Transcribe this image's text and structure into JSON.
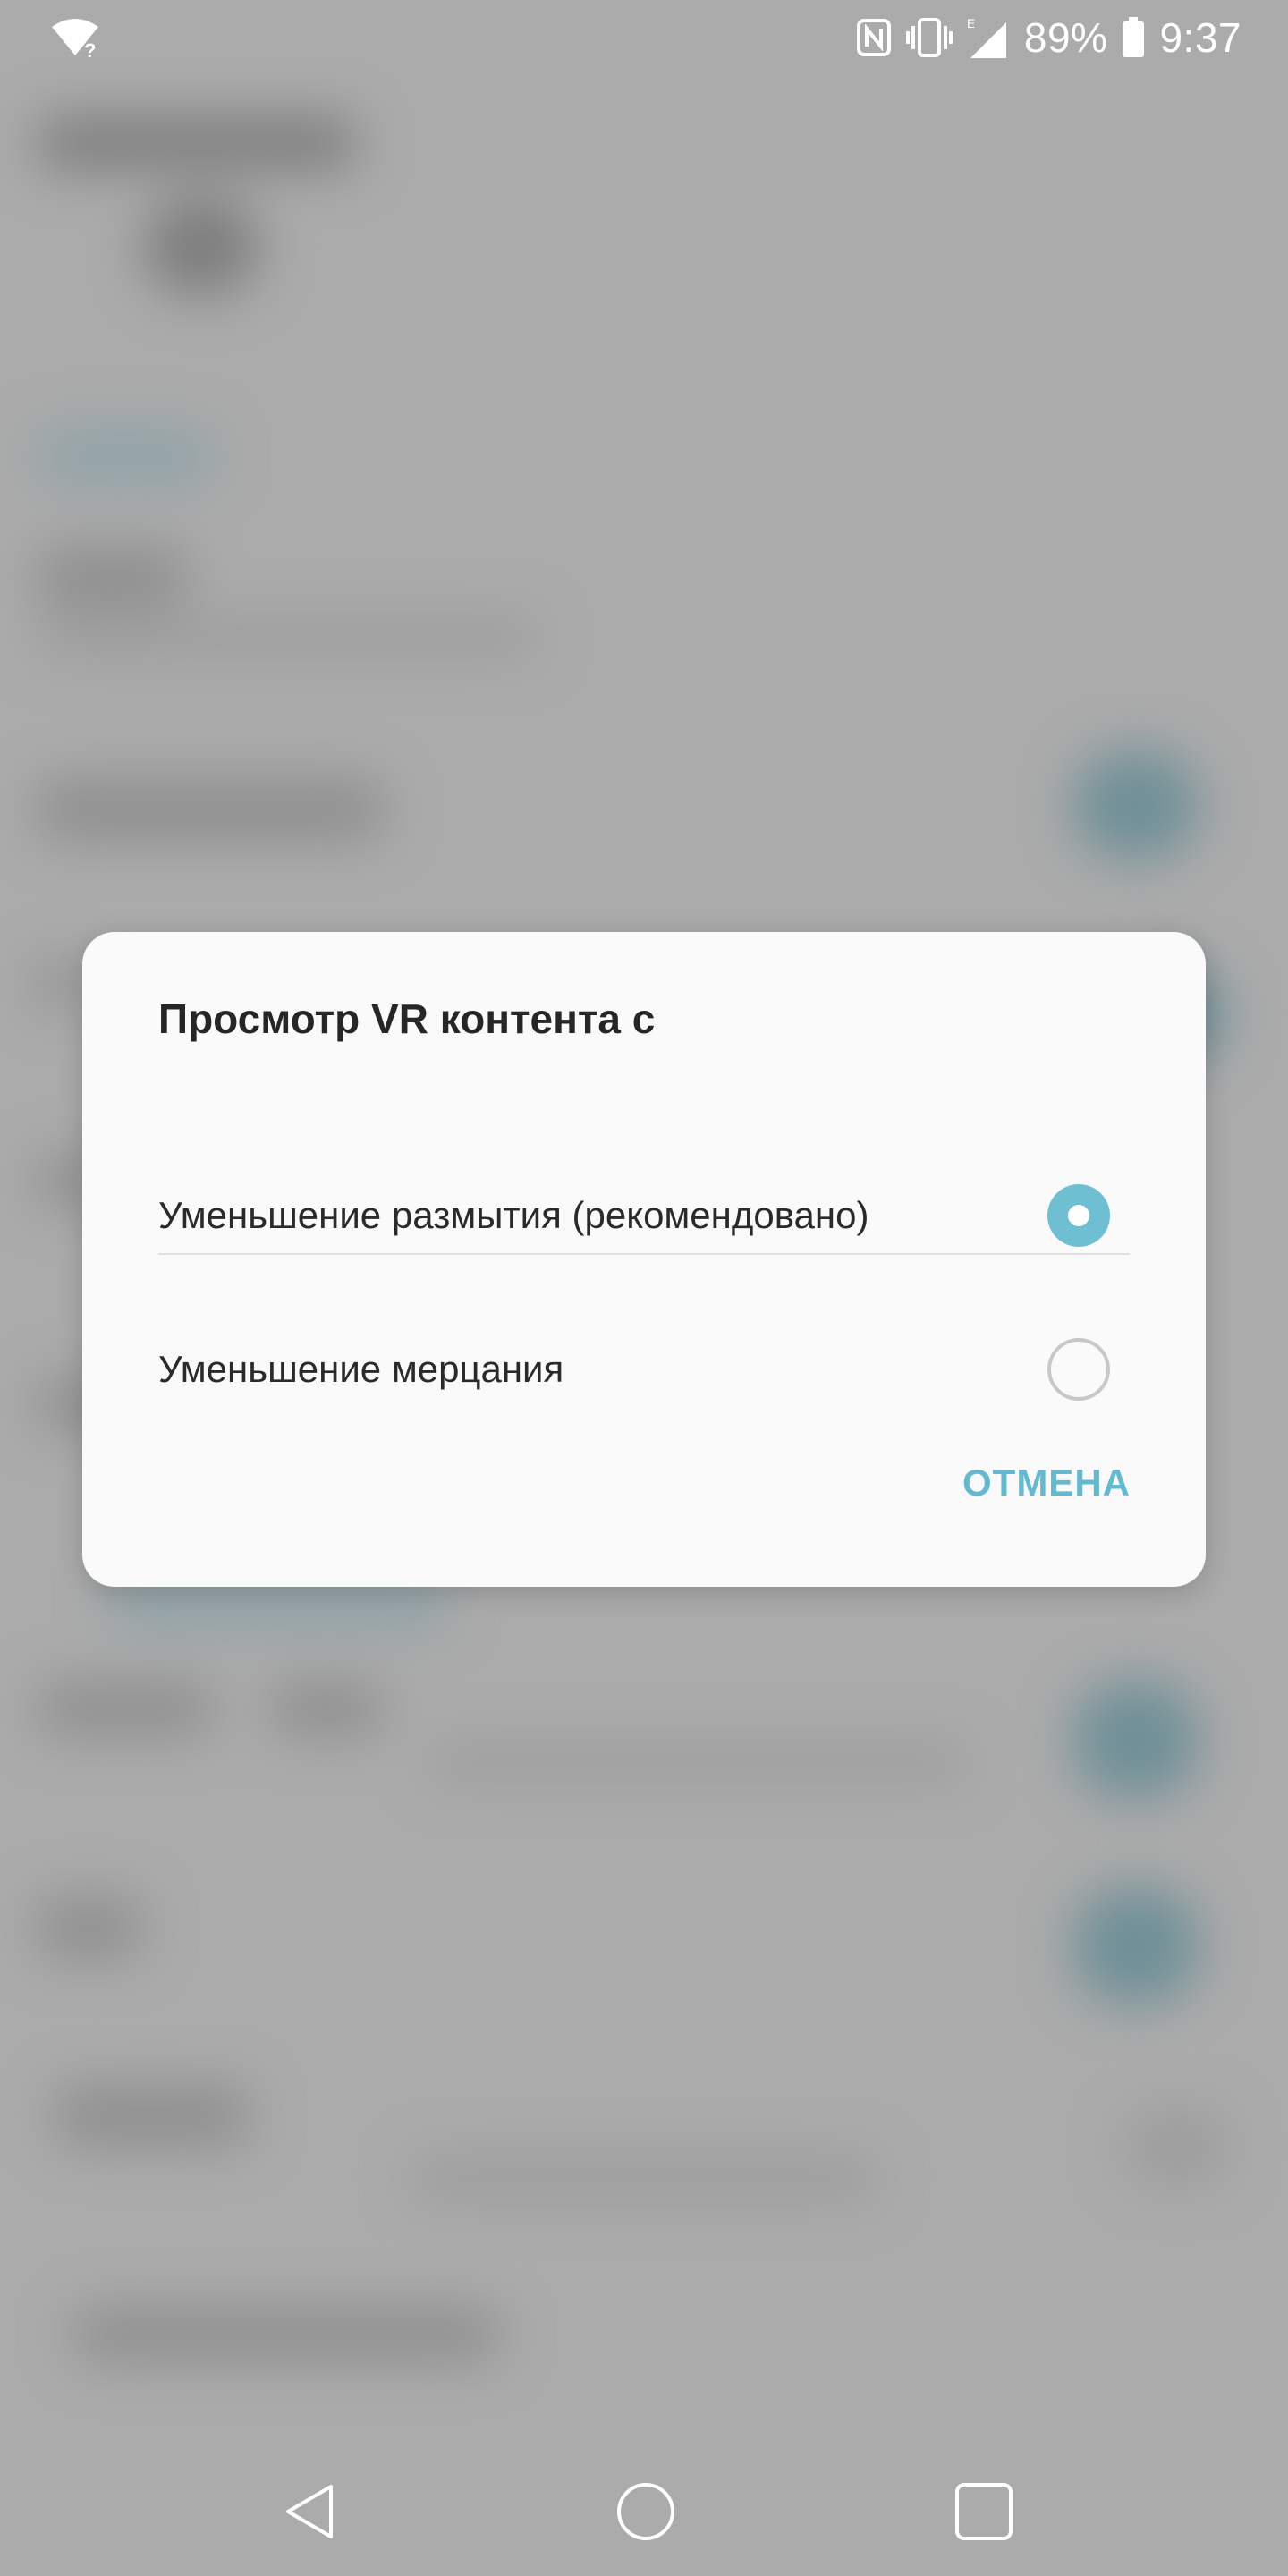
{
  "status_bar": {
    "battery_percent": "89%",
    "time": "9:37",
    "network_type": "E",
    "icons": [
      "wifi-unknown-icon",
      "nfc-icon",
      "vibrate-icon",
      "signal-icon",
      "battery-icon"
    ]
  },
  "dialog": {
    "title": "Просмотр VR контента с",
    "options": [
      {
        "label": "Уменьшение размытия (рекомендовано)",
        "selected": true
      },
      {
        "label": "Уменьшение мерцания",
        "selected": false
      }
    ],
    "cancel_label": "ОТМЕНА"
  },
  "colors": {
    "accent": "#62b9d0",
    "radio_selected": "#6fbfd3",
    "dialog_bg": "#fafafa",
    "scrim": "#ababab"
  },
  "nav_bar": {
    "buttons": [
      "back-icon",
      "home-icon",
      "recent-apps-icon"
    ]
  }
}
